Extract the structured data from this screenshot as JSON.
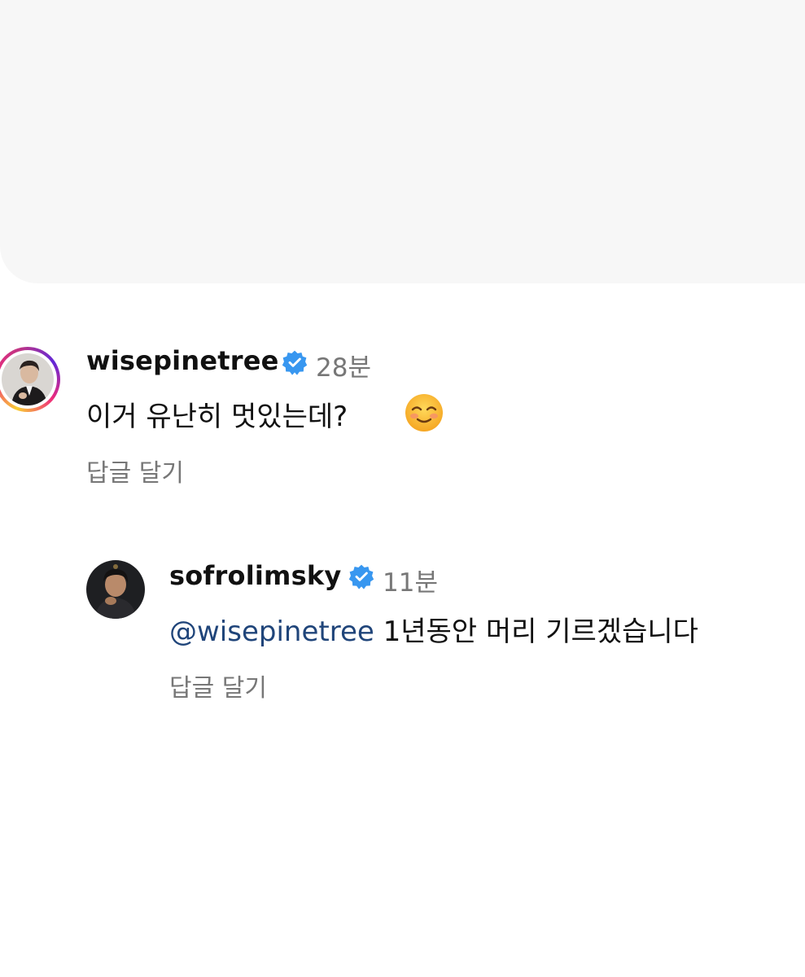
{
  "comments": [
    {
      "username": "wisepinetree",
      "verified": true,
      "timestamp": "28분",
      "text": "이거 유난히 멋있는데?",
      "emoji": "smiling-face-with-smiling-eyes",
      "reply_label": "답글 달기",
      "story_ring": true
    },
    {
      "username": "sofrolimsky",
      "verified": true,
      "timestamp": "11분",
      "mention": "@wisepinetree",
      "text": " 1년동안 머리 기르겠습니다",
      "reply_label": "답글 달기",
      "story_ring": false
    }
  ],
  "colors": {
    "verified_badge": "#3897f0",
    "mention": "#20457a",
    "secondary_text": "#777777",
    "top_panel": "#f7f7f7"
  }
}
